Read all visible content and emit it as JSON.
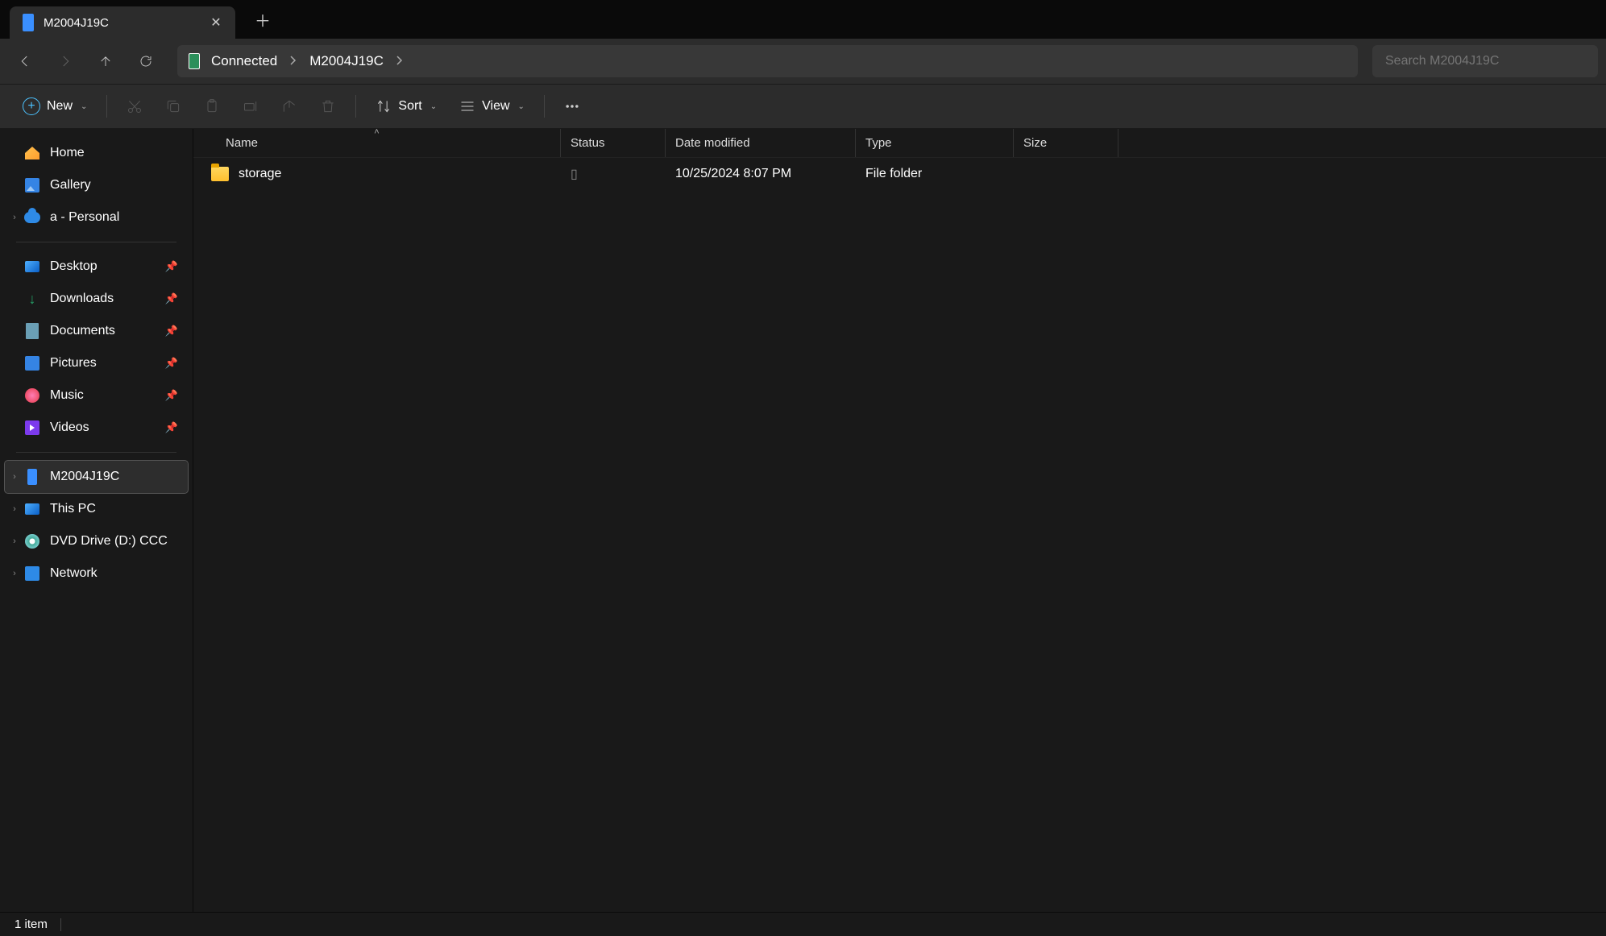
{
  "tab": {
    "title": "M2004J19C"
  },
  "breadcrumbs": [
    {
      "label": "Connected"
    },
    {
      "label": "M2004J19C"
    }
  ],
  "search": {
    "placeholder": "Search M2004J19C"
  },
  "toolbar": {
    "new_label": "New",
    "sort_label": "Sort",
    "view_label": "View"
  },
  "sidebar": {
    "home": "Home",
    "gallery": "Gallery",
    "onedrive": "a - Personal",
    "quick": [
      {
        "label": "Desktop"
      },
      {
        "label": "Downloads"
      },
      {
        "label": "Documents"
      },
      {
        "label": "Pictures"
      },
      {
        "label": "Music"
      },
      {
        "label": "Videos"
      }
    ],
    "device": "M2004J19C",
    "thispc": "This PC",
    "dvd": "DVD Drive (D:) CCC",
    "network": "Network"
  },
  "columns": {
    "name": "Name",
    "status": "Status",
    "date": "Date modified",
    "type": "Type",
    "size": "Size"
  },
  "rows": [
    {
      "name": "storage",
      "status": "",
      "date": "10/25/2024 8:07 PM",
      "type": "File folder",
      "size": ""
    }
  ],
  "statusbar": {
    "count": "1 item"
  }
}
